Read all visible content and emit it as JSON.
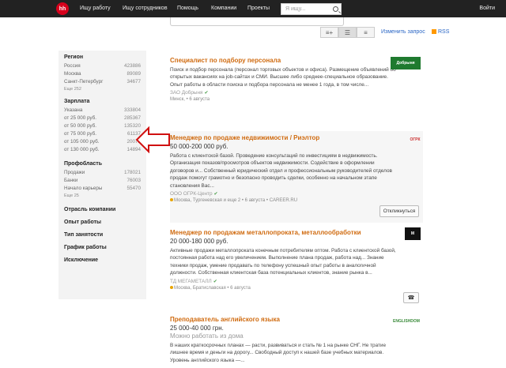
{
  "topbar": {
    "logo": "hh",
    "nav": [
      "Ищу работу",
      "Ищу сотрудников",
      "Помощь",
      "Компании",
      "Проекты"
    ],
    "search_placeholder": "Я ищу...",
    "login": "Войти"
  },
  "controls": {
    "change_query": "Изменить запрос",
    "rss": "RSS"
  },
  "sidebar": {
    "region": {
      "title": "Регион",
      "items": [
        {
          "label": "Россия",
          "count": "423886"
        },
        {
          "label": "Москва",
          "count": "89089"
        },
        {
          "label": "Санкт-Петербург",
          "count": "34677"
        }
      ],
      "more": "Еще 252"
    },
    "salary": {
      "title": "Зарплата",
      "items": [
        {
          "label": "Указана",
          "count": "333804"
        },
        {
          "label": "от 25 000 руб.",
          "count": "285367"
        },
        {
          "label": "от 50 000 руб.",
          "count": "135320"
        },
        {
          "label": "от 75 000 руб.",
          "count": "61137"
        },
        {
          "label": "от 105 000 руб.",
          "count": "20072"
        },
        {
          "label": "от 130 000 руб.",
          "count": "14894"
        }
      ]
    },
    "profarea": {
      "title": "Профобласть",
      "items": [
        {
          "label": "Продажи",
          "count": "178021"
        },
        {
          "label": "Банки",
          "count": "76003"
        },
        {
          "label": "Начало карьеры",
          "count": "55470"
        }
      ],
      "more": "Еще 25"
    },
    "links": [
      "Отрасль компании",
      "Опыт работы",
      "Тип занятости",
      "График работы",
      "Исключение"
    ]
  },
  "vacancies": [
    {
      "title": "Специалист по подбору персонала",
      "salary": "",
      "desc": "Поиск и подбор персонала (персонал торговых объектов и офиса). Размещение объявлений об открытых вакансиях на job-сайтах и СМИ. Высшее либо среднее-специальное образование. Опыт работы в области поиска и подбора персонала не менее 1 года, в том числе...",
      "company": "ЗАО Добрыня",
      "meta": "Минск,  •  6 августа",
      "logo_text": "Добрыня"
    },
    {
      "title": "Менеджер по продаже недвижимости / Риэлтор",
      "salary": "50 000-200 000 руб.",
      "desc": "Работа с клиентской базой. Проведение консультаций по инвестициям в недвижимость. Организация показов/просмотров объектов недвижимости. Содействие в оформлении договоров и... Собственный юридический отдел и профессиональным руководителей отделов продаж помогут грамотно и безопасно проводить сделки, особенно на начальном этапе становления Вас...",
      "company": "ООО ОГРК-Центр",
      "meta": "Москва, Тургеневская и еще 2  •  6 августа  •  CAREER.RU",
      "respond": "Откликнуться",
      "logo_text": "ОГРК"
    },
    {
      "title": "Менеджер по продажам металлопроката, металлообработки",
      "salary": "20 000-180 000 руб.",
      "desc": "Активные продажи металлопроката конечным потребителям оптом. Работа с клиентской базой, постоянная работа над его увеличением. Выполнение плана продаж, работа над... Знание техники продаж, умение продавать по телефону успешный опыт работы в аналогичной должности. Собственная клиентская база потенциальных клиентов, знание рынка в...",
      "company": "ТД МЕГАМЕТАЛЛ",
      "meta": "Москва, Братиславская  •  6 августа",
      "logo_text": "М"
    },
    {
      "title": "Преподаватель английского языка",
      "salary": "25 000-40 000 грн.",
      "home": "Можно работать из дома",
      "desc": "В наших краткосрочных планах — расти, развиваться и стать № 1 на рынке СНГ. Не тратие лишнее время и деньги на дорогу... Свободный доступ к нашей базе учебных материалов. Уровень английского языка —...",
      "logo_text": "ENGLISHDOM"
    }
  ],
  "colors": {
    "accent": "#d06b10",
    "link": "#2a66c5",
    "topbar": "#222222",
    "brand": "#d6001c"
  }
}
